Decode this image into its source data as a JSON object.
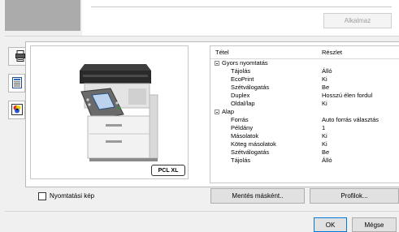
{
  "top": {
    "apply_label": "Alkalmaz"
  },
  "sidebar": {
    "tabs": [
      {
        "icon": "printer-icon"
      },
      {
        "icon": "document-list-icon"
      },
      {
        "icon": "color-icon"
      }
    ]
  },
  "preview": {
    "badge": "PCL XL"
  },
  "settings": {
    "col_item": "Tétel",
    "col_detail": "Részlet",
    "groups": [
      {
        "name": "Gyors nyomtatás",
        "rows": [
          {
            "label": "Tájolás",
            "value": "Álló"
          },
          {
            "label": "EcoPrint",
            "value": "Ki"
          },
          {
            "label": "Szétválogatás",
            "value": "Be"
          },
          {
            "label": "Duplex",
            "value": "Hosszú élen fordul"
          },
          {
            "label": "Oldal/lap",
            "value": "Ki"
          }
        ]
      },
      {
        "name": "Alap",
        "rows": [
          {
            "label": "Forrás",
            "value": "Auto forrás választás"
          },
          {
            "label": "Példány",
            "value": "1"
          },
          {
            "label": "Másolatok",
            "value": "Ki"
          },
          {
            "label": "Köteg másolatok",
            "value": "Ki"
          },
          {
            "label": "Szétválogatás",
            "value": "Be"
          },
          {
            "label": "Tájolás",
            "value": "Álló"
          }
        ]
      }
    ]
  },
  "print_image": {
    "label": "Nyomtatási kép",
    "checked": false
  },
  "buttons": {
    "save_as": "Mentés másként..",
    "profiles": "Profilok...",
    "ok": "OK",
    "cancel": "Mégse"
  }
}
